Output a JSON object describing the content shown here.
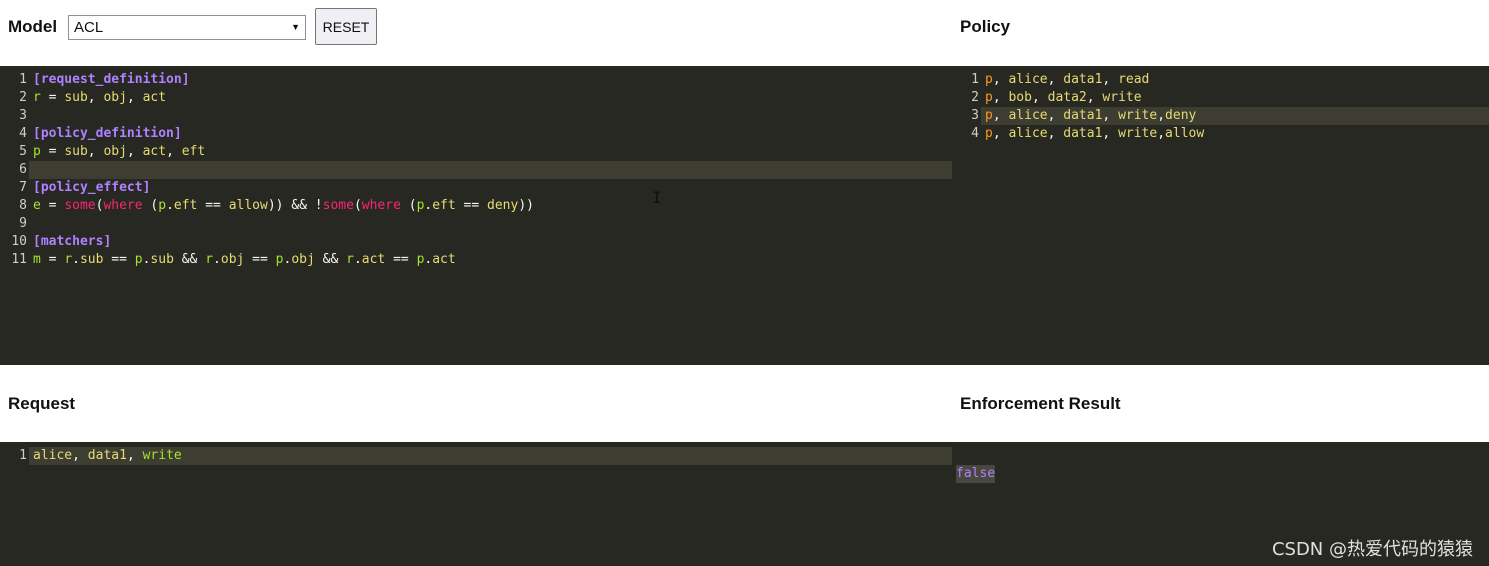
{
  "model": {
    "label": "Model",
    "selected": "ACL",
    "reset_label": "RESET",
    "lines": [
      [
        {
          "t": "[request_definition]",
          "c": "sec"
        }
      ],
      [
        {
          "t": "r",
          "c": "var"
        },
        {
          "t": " = ",
          "c": "op"
        },
        {
          "t": "sub",
          "c": "id"
        },
        {
          "t": ", ",
          "c": "op"
        },
        {
          "t": "obj",
          "c": "id"
        },
        {
          "t": ", ",
          "c": "op"
        },
        {
          "t": "act",
          "c": "id"
        }
      ],
      [],
      [
        {
          "t": "[policy_definition]",
          "c": "sec"
        }
      ],
      [
        {
          "t": "p",
          "c": "var"
        },
        {
          "t": " = ",
          "c": "op"
        },
        {
          "t": "sub",
          "c": "id"
        },
        {
          "t": ", ",
          "c": "op"
        },
        {
          "t": "obj",
          "c": "id"
        },
        {
          "t": ", ",
          "c": "op"
        },
        {
          "t": "act",
          "c": "id"
        },
        {
          "t": ", ",
          "c": "op"
        },
        {
          "t": "eft",
          "c": "id"
        }
      ],
      [],
      [
        {
          "t": "[policy_effect]",
          "c": "sec"
        }
      ],
      [
        {
          "t": "e",
          "c": "var"
        },
        {
          "t": " = ",
          "c": "op"
        },
        {
          "t": "some",
          "c": "kw"
        },
        {
          "t": "(",
          "c": "op"
        },
        {
          "t": "where",
          "c": "kw"
        },
        {
          "t": " (",
          "c": "op"
        },
        {
          "t": "p",
          "c": "var"
        },
        {
          "t": ".",
          "c": "op"
        },
        {
          "t": "eft",
          "c": "id"
        },
        {
          "t": " == ",
          "c": "op"
        },
        {
          "t": "allow",
          "c": "id"
        },
        {
          "t": ")) && !",
          "c": "op"
        },
        {
          "t": "some",
          "c": "kw"
        },
        {
          "t": "(",
          "c": "op"
        },
        {
          "t": "where",
          "c": "kw"
        },
        {
          "t": " (",
          "c": "op"
        },
        {
          "t": "p",
          "c": "var"
        },
        {
          "t": ".",
          "c": "op"
        },
        {
          "t": "eft",
          "c": "id"
        },
        {
          "t": " == ",
          "c": "op"
        },
        {
          "t": "deny",
          "c": "id"
        },
        {
          "t": "))",
          "c": "op"
        }
      ],
      [],
      [
        {
          "t": "[matchers]",
          "c": "sec"
        }
      ],
      [
        {
          "t": "m",
          "c": "var"
        },
        {
          "t": " = ",
          "c": "op"
        },
        {
          "t": "r",
          "c": "var"
        },
        {
          "t": ".",
          "c": "op"
        },
        {
          "t": "sub",
          "c": "id"
        },
        {
          "t": " == ",
          "c": "op"
        },
        {
          "t": "p",
          "c": "var"
        },
        {
          "t": ".",
          "c": "op"
        },
        {
          "t": "sub",
          "c": "id"
        },
        {
          "t": " && ",
          "c": "op"
        },
        {
          "t": "r",
          "c": "var"
        },
        {
          "t": ".",
          "c": "op"
        },
        {
          "t": "obj",
          "c": "id"
        },
        {
          "t": " == ",
          "c": "op"
        },
        {
          "t": "p",
          "c": "var"
        },
        {
          "t": ".",
          "c": "op"
        },
        {
          "t": "obj",
          "c": "id"
        },
        {
          "t": " && ",
          "c": "op"
        },
        {
          "t": "r",
          "c": "var"
        },
        {
          "t": ".",
          "c": "op"
        },
        {
          "t": "act",
          "c": "id"
        },
        {
          "t": " == ",
          "c": "op"
        },
        {
          "t": "p",
          "c": "var"
        },
        {
          "t": ".",
          "c": "op"
        },
        {
          "t": "act",
          "c": "id"
        }
      ]
    ],
    "active_line": 6
  },
  "policy": {
    "label": "Policy",
    "lines": [
      [
        {
          "t": "p",
          "c": "kw2"
        },
        {
          "t": ", ",
          "c": "op"
        },
        {
          "t": "alice",
          "c": "id"
        },
        {
          "t": ", ",
          "c": "op"
        },
        {
          "t": "data1",
          "c": "id"
        },
        {
          "t": ", ",
          "c": "op"
        },
        {
          "t": "read",
          "c": "id"
        }
      ],
      [
        {
          "t": "p",
          "c": "kw2"
        },
        {
          "t": ", ",
          "c": "op"
        },
        {
          "t": "bob",
          "c": "id"
        },
        {
          "t": ", ",
          "c": "op"
        },
        {
          "t": "data2",
          "c": "id"
        },
        {
          "t": ", ",
          "c": "op"
        },
        {
          "t": "write",
          "c": "id"
        }
      ],
      [
        {
          "t": "p",
          "c": "kw2"
        },
        {
          "t": ", ",
          "c": "op"
        },
        {
          "t": "alice",
          "c": "id"
        },
        {
          "t": ", ",
          "c": "op"
        },
        {
          "t": "data1",
          "c": "id"
        },
        {
          "t": ", ",
          "c": "op"
        },
        {
          "t": "write",
          "c": "id"
        },
        {
          "t": ",",
          "c": "op"
        },
        {
          "t": "deny",
          "c": "id"
        }
      ],
      [
        {
          "t": "p",
          "c": "kw2"
        },
        {
          "t": ", ",
          "c": "op"
        },
        {
          "t": "alice",
          "c": "id"
        },
        {
          "t": ", ",
          "c": "op"
        },
        {
          "t": "data1",
          "c": "id"
        },
        {
          "t": ", ",
          "c": "op"
        },
        {
          "t": "write",
          "c": "id"
        },
        {
          "t": ",",
          "c": "op"
        },
        {
          "t": "allow",
          "c": "id"
        }
      ]
    ],
    "active_line": 3
  },
  "request": {
    "label": "Request",
    "lines": [
      [
        {
          "t": "alice",
          "c": "id"
        },
        {
          "t": ", ",
          "c": "op"
        },
        {
          "t": "data1",
          "c": "id"
        },
        {
          "t": ", ",
          "c": "op"
        },
        {
          "t": "write",
          "c": "var"
        }
      ]
    ],
    "active_line": 1
  },
  "result": {
    "label": "Enforcement Result",
    "value": "false"
  },
  "watermark": "CSDN @热爱代码的猿猿",
  "colors": {
    "editor_bg": "#272822",
    "section": "#ae81ff",
    "keyword": "#f92672",
    "variable": "#a6e22e",
    "identifier": "#e6db74",
    "policy_type": "#fd971f"
  }
}
